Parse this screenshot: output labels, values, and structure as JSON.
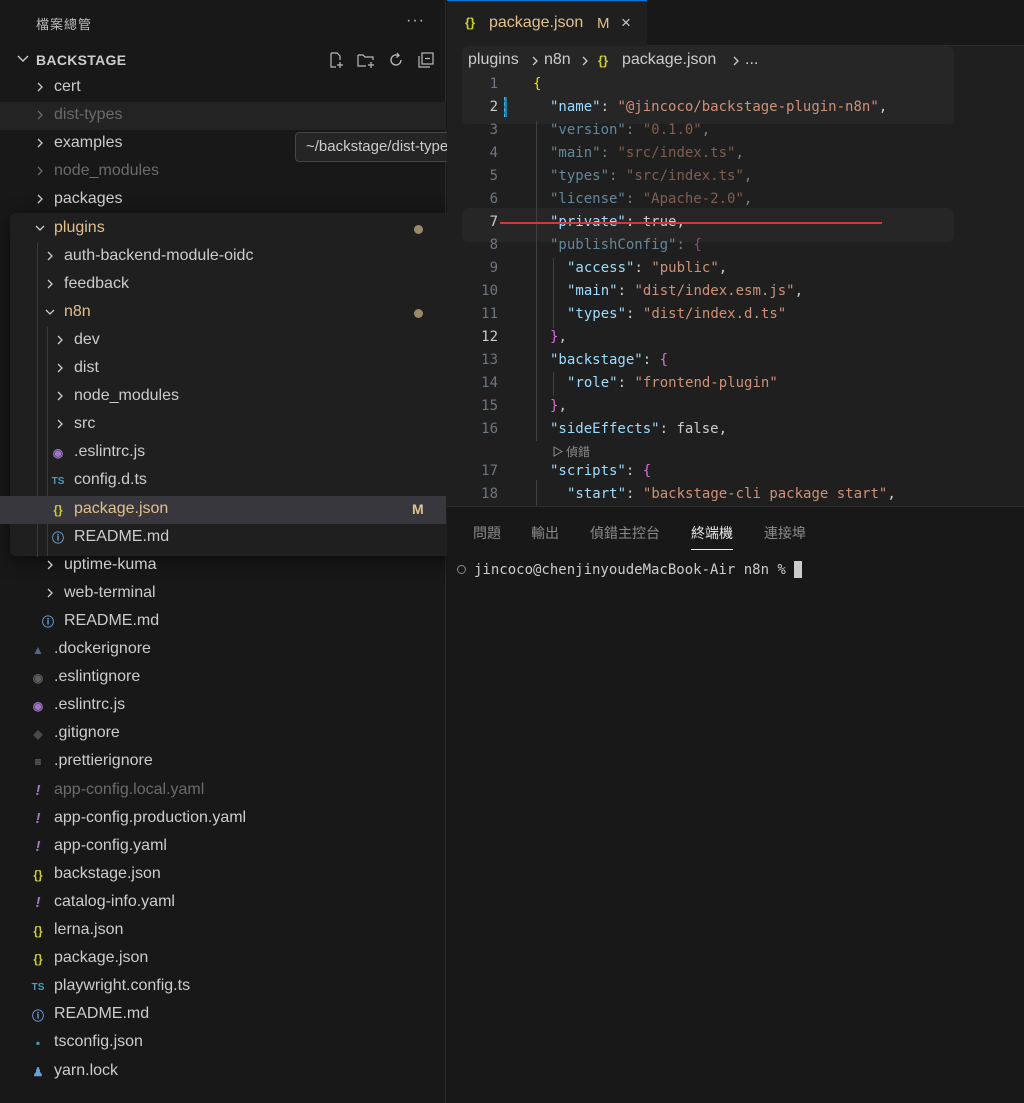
{
  "explorer": {
    "header": "檔案總管",
    "more": "···",
    "root": "BACKSTAGE",
    "tooltip": "~/backstage/dist-types",
    "tree": [
      {
        "label": "cert",
        "type": "folder",
        "open": false
      },
      {
        "label": "dist-types",
        "type": "folder",
        "open": false,
        "dim": true
      },
      {
        "label": "examples",
        "type": "folder",
        "open": false
      },
      {
        "label": "node_modules",
        "type": "folder",
        "open": false,
        "dim": true
      },
      {
        "label": "packages",
        "type": "folder",
        "open": false
      },
      {
        "label": "plugins",
        "type": "folder",
        "open": true,
        "modified": true
      },
      {
        "label": "auth-backend-module-oidc",
        "type": "folder",
        "open": false
      },
      {
        "label": "feedback",
        "type": "folder",
        "open": false
      },
      {
        "label": "n8n",
        "type": "folder",
        "open": true,
        "modified": true
      },
      {
        "label": "dev",
        "type": "folder",
        "open": false
      },
      {
        "label": "dist",
        "type": "folder",
        "open": false
      },
      {
        "label": "node_modules",
        "type": "folder",
        "open": false
      },
      {
        "label": "src",
        "type": "folder",
        "open": false
      },
      {
        "label": ".eslintrc.js",
        "type": "eslint"
      },
      {
        "label": "config.d.ts",
        "type": "ts"
      },
      {
        "label": "package.json",
        "type": "json",
        "badge": "M"
      },
      {
        "label": "README.md",
        "type": "info"
      },
      {
        "label": "uptime-kuma",
        "type": "folder",
        "open": false
      },
      {
        "label": "web-terminal",
        "type": "folder",
        "open": false
      },
      {
        "label": "README.md",
        "type": "info"
      },
      {
        "label": ".dockerignore",
        "type": "docker"
      },
      {
        "label": ".eslintignore",
        "type": "eslintignore"
      },
      {
        "label": ".eslintrc.js",
        "type": "eslint"
      },
      {
        "label": ".gitignore",
        "type": "git"
      },
      {
        "label": ".prettierignore",
        "type": "lines"
      },
      {
        "label": "app-config.local.yaml",
        "type": "yaml",
        "dim": true
      },
      {
        "label": "app-config.production.yaml",
        "type": "yaml"
      },
      {
        "label": "app-config.yaml",
        "type": "yaml"
      },
      {
        "label": "backstage.json",
        "type": "json"
      },
      {
        "label": "catalog-info.yaml",
        "type": "yaml"
      },
      {
        "label": "lerna.json",
        "type": "json"
      },
      {
        "label": "package.json",
        "type": "json"
      },
      {
        "label": "playwright.config.ts",
        "type": "ts"
      },
      {
        "label": "README.md",
        "type": "info"
      },
      {
        "label": "tsconfig.json",
        "type": "tsconfig"
      },
      {
        "label": "yarn.lock",
        "type": "yarn"
      }
    ]
  },
  "editor": {
    "tab": {
      "icon": "{}",
      "label": "package.json",
      "status": "M",
      "close": "×"
    },
    "breadcrumb": [
      "plugins",
      "n8n",
      "package.json",
      "..."
    ],
    "codelens": "偵錯",
    "lines": [
      {
        "n": "1",
        "text": "{"
      },
      {
        "n": "2",
        "text": "\"name\": \"@jincoco/backstage-plugin-n8n\","
      },
      {
        "n": "3",
        "text": "\"version\": \"0.1.0\","
      },
      {
        "n": "4",
        "text": "\"main\": \"src/index.ts\","
      },
      {
        "n": "5",
        "text": "\"types\": \"src/index.ts\","
      },
      {
        "n": "6",
        "text": "\"license\": \"Apache-2.0\","
      },
      {
        "n": "7",
        "text": "\"private\": true,"
      },
      {
        "n": "8",
        "text": "\"publishConfig\": {"
      },
      {
        "n": "9",
        "text": "\"access\": \"public\","
      },
      {
        "n": "10",
        "text": "\"main\": \"dist/index.esm.js\","
      },
      {
        "n": "11",
        "text": "\"types\": \"dist/index.d.ts\""
      },
      {
        "n": "12",
        "text": "},"
      },
      {
        "n": "13",
        "text": "\"backstage\": {"
      },
      {
        "n": "14",
        "text": "\"role\": \"frontend-plugin\""
      },
      {
        "n": "15",
        "text": "},"
      },
      {
        "n": "16",
        "text": "\"sideEffects\": false,"
      },
      {
        "n": "17",
        "text": "\"scripts\": {"
      },
      {
        "n": "18",
        "text": "\"start\": \"backstage-cli package start\","
      }
    ]
  },
  "panel": {
    "tabs": [
      "問題",
      "輸出",
      "偵錯主控台",
      "終端機",
      "連接埠"
    ],
    "active_tab": "終端機",
    "prompt": "jincoco@chenjinyoudeMacBook-Air n8n %"
  },
  "colors": {
    "accent": "#0078d4",
    "modified": "#e2c08d",
    "json_icon": "#cbcb41",
    "strike": "#e0303a"
  }
}
